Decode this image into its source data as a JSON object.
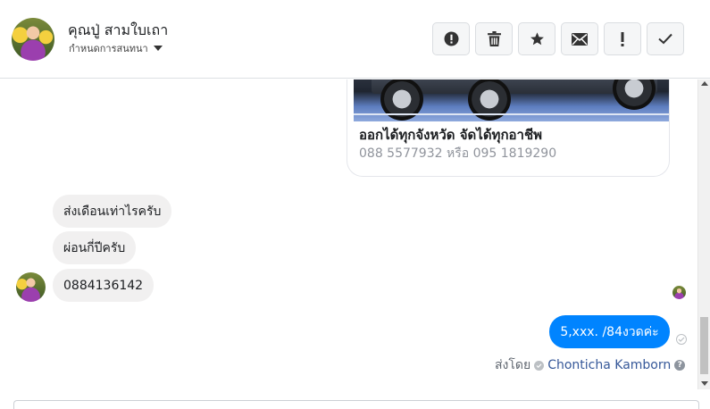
{
  "header": {
    "user_name": "คุณปู่ สามใบเถา",
    "assign_label": "กำหนดการสนทนา",
    "avatar_icon": "user-avatar",
    "toolbar": [
      {
        "name": "mark-spam-button",
        "icon": "exclamation-circle-icon"
      },
      {
        "name": "delete-button",
        "icon": "trash-icon"
      },
      {
        "name": "star-button",
        "icon": "star-icon"
      },
      {
        "name": "mark-unread-button",
        "icon": "envelope-icon"
      },
      {
        "name": "important-button",
        "icon": "exclamation-icon"
      },
      {
        "name": "mark-done-button",
        "icon": "check-icon"
      }
    ]
  },
  "thread": {
    "card": {
      "title": "ออกได้ทุกจังหวัด จัดได้ทุกอาชีพ",
      "subtitle": "088 5577932 หรือ 095 1819290"
    },
    "incoming": [
      {
        "text": "ส่งเดือนเท่าไรครับ"
      },
      {
        "text": "ผ่อนกี่ปีครับ"
      },
      {
        "text": "0884136142"
      }
    ],
    "outgoing": {
      "text": "5,xxx. /84งวดค่ะ"
    },
    "sent_by": {
      "prefix": "ส่งโดย",
      "agent": "Chonticha Kamborn",
      "help": "?"
    }
  },
  "colors": {
    "accent": "#0084ff",
    "incoming_bubble": "#f1f0f0",
    "link": "#365899"
  }
}
